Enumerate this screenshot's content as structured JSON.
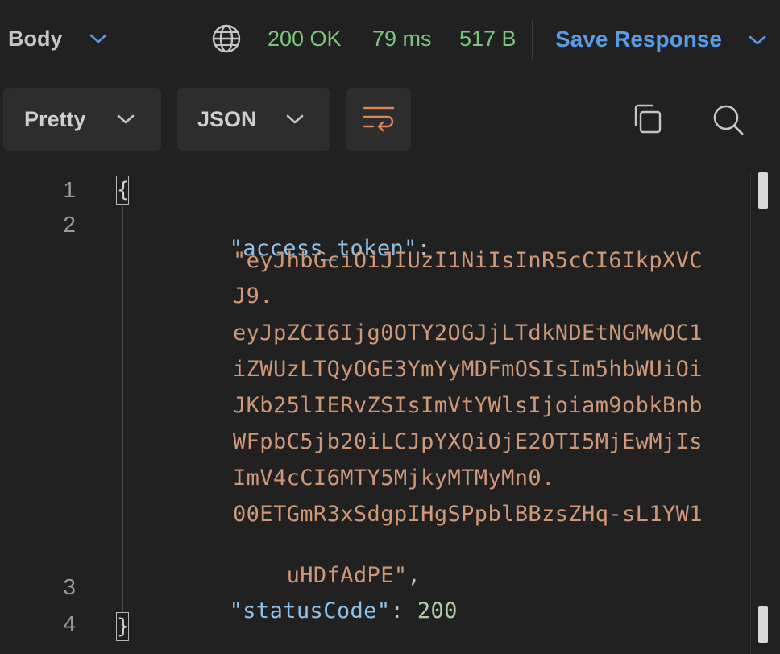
{
  "header": {
    "body_label": "Body",
    "status_code": "200 OK",
    "response_time": "79 ms",
    "response_size": "517 B",
    "save_label": "Save Response"
  },
  "toolbar": {
    "format_label": "Pretty",
    "language_label": "JSON"
  },
  "editor": {
    "line_numbers": [
      "1",
      "2",
      "3",
      "4"
    ],
    "open_brace": "{",
    "close_brace": "}",
    "token_key": "\"access_token\"",
    "colon": ":",
    "token_lines": [
      "\"eyJhbGciOiJIUzI1NiIsInR5cCI6IkpXVC",
      "J9.",
      "eyJpZCI6Ijg0OTY2OGJjLTdkNDEtNGMwOC1",
      "iZWUzLTQyOGE3YmYyMDFmOSIsIm5hbWUiOi",
      "JKb25lIERvZSIsImVtYWlsIjoiam9obkBnb",
      "WFpbC5jb20iLCJpYXQiOjE2OTI5MjEwMjIs",
      "ImV4cCI6MTY5MjkyMTMyMn0.",
      "00ETGmR3xSdgpIHgSPpblBBzsZHq-sL1YW1",
      "uHDfAdPE\""
    ],
    "comma": ",",
    "status_key": "\"statusCode\"",
    "status_sep": ": ",
    "status_value": "200"
  },
  "icons": {
    "globe": "globe-icon",
    "copy": "copy-icon",
    "search": "search-icon",
    "wrap": "wrap-lines-icon",
    "chevron": "chevron-down-icon"
  },
  "colors": {
    "status_ok": "#7dc47d",
    "save_accent": "#5a9ae6",
    "wrap_accent": "#e0855a",
    "json_key": "#8fc1e8",
    "json_string": "#cf9878",
    "json_number": "#b5cea8"
  }
}
